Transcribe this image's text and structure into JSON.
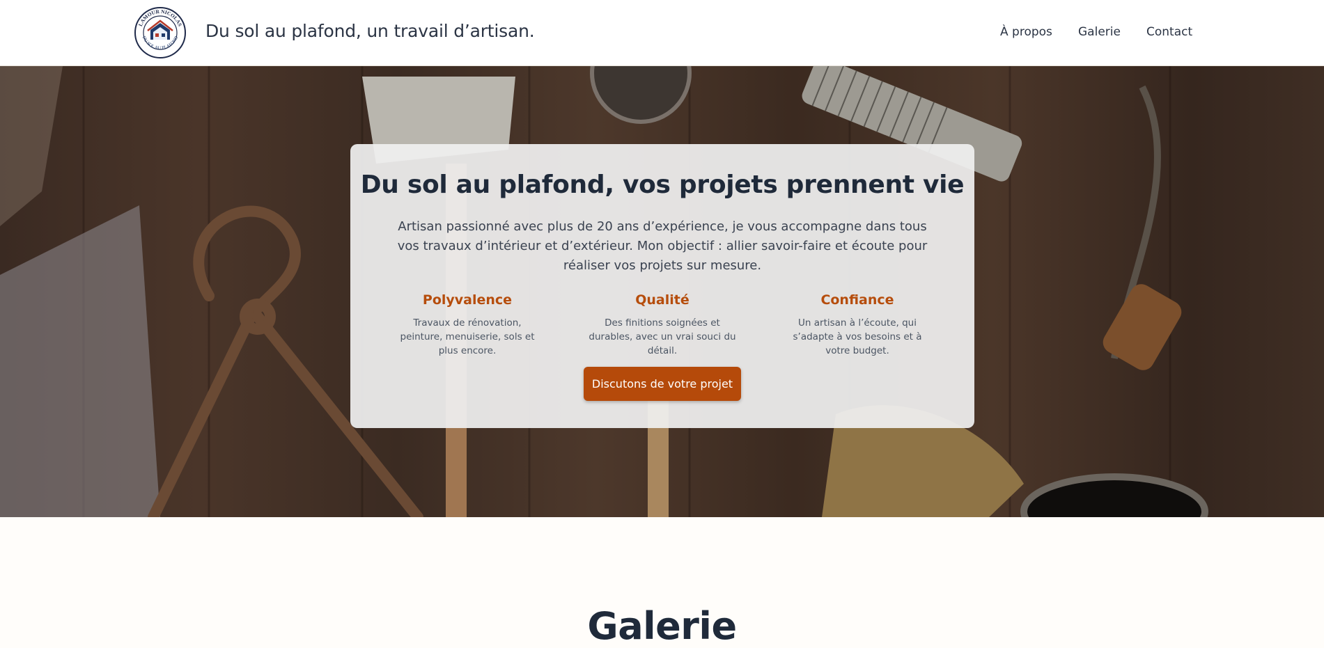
{
  "header": {
    "logo": {
      "icon": "house-logo-icon",
      "ring_text_top": "LAMOUR NICOLAS",
      "ring_text_bottom": "DU SOL AU PLAFOND"
    },
    "tagline": "Du sol au plafond, un travail d’artisan.",
    "nav": {
      "about": "À propos",
      "gallery": "Galerie",
      "contact": "Contact"
    }
  },
  "hero": {
    "title": "Du sol au plafond, vos projets prennent vie",
    "intro": "Artisan passionné avec plus de 20 ans d’expérience, je vous accompagne dans tous vos travaux d’intérieur et d’extérieur. Mon objectif : allier savoir-faire et écoute pour réaliser vos projets sur mesure.",
    "features": [
      {
        "title": "Polyvalence",
        "text": "Travaux de rénovation, peinture, menuiserie, sols et plus encore."
      },
      {
        "title": "Qualité",
        "text": "Des finitions soignées et durables, avec un vrai souci du détail."
      },
      {
        "title": "Confiance",
        "text": "Un artisan à l’écoute, qui s’adapte à vos besoins et à votre budget."
      }
    ],
    "cta": "Discutons de votre projet"
  },
  "gallery": {
    "title": "Galerie"
  },
  "colors": {
    "accent": "#b54a0a",
    "heading": "#1f2a3a",
    "background": "#fffdfa"
  }
}
